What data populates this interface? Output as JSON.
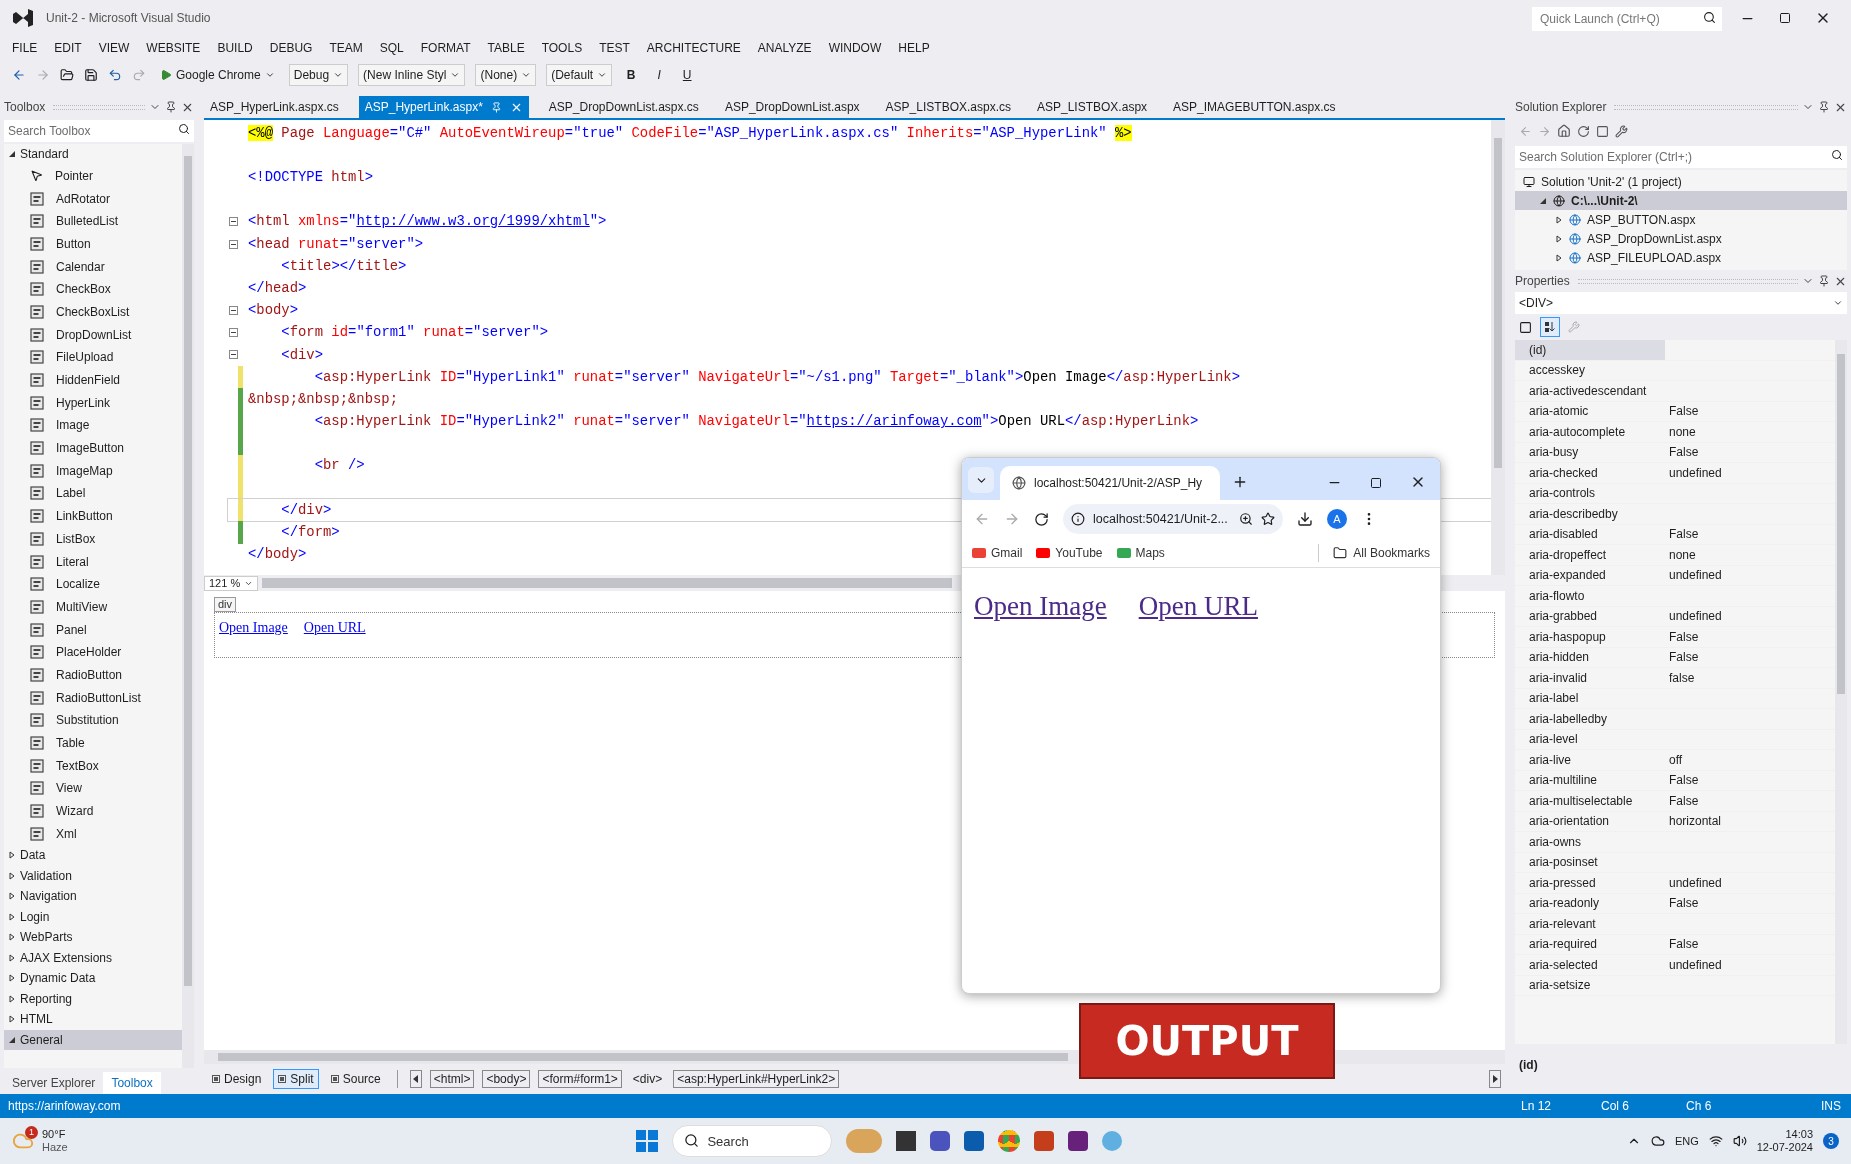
{
  "window": {
    "title": "Unit-2 - Microsoft Visual Studio",
    "quick_launch": {
      "placeholder": "Quick Launch (Ctrl+Q)"
    }
  },
  "menu": [
    "FILE",
    "EDIT",
    "VIEW",
    "WEBSITE",
    "BUILD",
    "DEBUG",
    "TEAM",
    "SQL",
    "FORMAT",
    "TABLE",
    "TOOLS",
    "TEST",
    "ARCHITECTURE",
    "ANALYZE",
    "WINDOW",
    "HELP"
  ],
  "toolbar": {
    "run": "Google Chrome",
    "configuration": "Debug",
    "style": "(New Inline Styl",
    "target_rule": "(None)",
    "font": "(Default",
    "format": [
      "B",
      "I",
      "U"
    ]
  },
  "toolbox": {
    "title": "Toolbox",
    "search": {
      "placeholder": "Search Toolbox"
    },
    "groups": [
      {
        "name": "Standard",
        "expanded": true,
        "selected": false,
        "items": [
          "Pointer",
          "AdRotator",
          "BulletedList",
          "Button",
          "Calendar",
          "CheckBox",
          "CheckBoxList",
          "DropDownList",
          "FileUpload",
          "HiddenField",
          "HyperLink",
          "Image",
          "ImageButton",
          "ImageMap",
          "Label",
          "LinkButton",
          "ListBox",
          "Literal",
          "Localize",
          "MultiView",
          "Panel",
          "PlaceHolder",
          "RadioButton",
          "RadioButtonList",
          "Substitution",
          "Table",
          "TextBox",
          "View",
          "Wizard",
          "Xml"
        ]
      },
      {
        "name": "Data",
        "expanded": false,
        "selected": false
      },
      {
        "name": "Validation",
        "expanded": false,
        "selected": false
      },
      {
        "name": "Navigation",
        "expanded": false,
        "selected": false
      },
      {
        "name": "Login",
        "expanded": false,
        "selected": false
      },
      {
        "name": "WebParts",
        "expanded": false,
        "selected": false
      },
      {
        "name": "AJAX Extensions",
        "expanded": false,
        "selected": false
      },
      {
        "name": "Dynamic Data",
        "expanded": false,
        "selected": false
      },
      {
        "name": "Reporting",
        "expanded": false,
        "selected": false
      },
      {
        "name": "HTML",
        "expanded": false,
        "selected": false
      },
      {
        "name": "General",
        "expanded": true,
        "selected": true
      }
    ]
  },
  "bottom_tabs": [
    {
      "label": "Server Explorer",
      "selected": false
    },
    {
      "label": "Toolbox",
      "selected": true
    }
  ],
  "editor": {
    "tabs": [
      {
        "label": "ASP_HyperLink.aspx.cs",
        "selected": false
      },
      {
        "label": "ASP_HyperLink.aspx*",
        "selected": true
      },
      {
        "label": "ASP_DropDownList.aspx.cs",
        "selected": false
      },
      {
        "label": "ASP_DropDownList.aspx",
        "selected": false
      },
      {
        "label": "ASP_LISTBOX.aspx.cs",
        "selected": false
      },
      {
        "label": "ASP_LISTBOX.aspx",
        "selected": false
      },
      {
        "label": "ASP_IMAGEBUTTON.aspx.cs",
        "selected": false
      }
    ],
    "lines": [
      {
        "tokens": [
          {
            "kind": "directive",
            "text": "<%@"
          },
          {
            "kind": "tag",
            "text": " Page"
          },
          {
            "kind": "attr",
            "text": " Language"
          },
          {
            "kind": "value",
            "text": "=\"C#\""
          },
          {
            "kind": "attr",
            "text": " AutoEventWireup"
          },
          {
            "kind": "value",
            "text": "=\"true\""
          },
          {
            "kind": "attr",
            "text": " CodeFile"
          },
          {
            "kind": "value",
            "text": "=\"ASP_HyperLink.aspx.cs\""
          },
          {
            "kind": "attr",
            "text": " Inherits"
          },
          {
            "kind": "value",
            "text": "=\"ASP_HyperLink\" "
          },
          {
            "kind": "directive",
            "text": "%>"
          }
        ],
        "modified": false,
        "fold": false,
        "current": false
      },
      {
        "modified": false,
        "fold": false,
        "current": false
      },
      {
        "tokens": [
          {
            "kind": "punct",
            "text": "<!DOCTYPE"
          },
          {
            "kind": "tag",
            "text": " html"
          },
          {
            "kind": "punct",
            "text": ">"
          }
        ],
        "modified": false,
        "fold": false,
        "current": false
      },
      {
        "modified": false,
        "fold": false,
        "current": false
      },
      {
        "tokens": [
          {
            "kind": "punct",
            "text": "<"
          },
          {
            "kind": "tag",
            "text": "html"
          },
          {
            "kind": "attr",
            "text": " xmlns"
          },
          {
            "kind": "punct",
            "text": "=\""
          },
          {
            "kind": "link",
            "text": "http://www.w3.org/1999/xhtml"
          },
          {
            "kind": "punct",
            "text": "\">"
          }
        ],
        "modified": false,
        "fold": true,
        "current": false
      },
      {
        "tokens": [
          {
            "kind": "punct",
            "text": "<"
          },
          {
            "kind": "tag",
            "text": "head"
          },
          {
            "kind": "attr",
            "text": " runat"
          },
          {
            "kind": "value",
            "text": "=\"server\""
          },
          {
            "kind": "punct",
            "text": ">"
          }
        ],
        "modified": false,
        "fold": true,
        "current": false
      },
      {
        "tokens": [
          {
            "kind": "punct",
            "text": "    <"
          },
          {
            "kind": "tag",
            "text": "title"
          },
          {
            "kind": "punct",
            "text": "></"
          },
          {
            "kind": "tag",
            "text": "title"
          },
          {
            "kind": "punct",
            "text": ">"
          }
        ],
        "modified": false,
        "fold": false,
        "current": false
      },
      {
        "tokens": [
          {
            "kind": "punct",
            "text": "</"
          },
          {
            "kind": "tag",
            "text": "head"
          },
          {
            "kind": "punct",
            "text": ">"
          }
        ],
        "modified": false,
        "fold": false,
        "current": false
      },
      {
        "tokens": [
          {
            "kind": "punct",
            "text": "<"
          },
          {
            "kind": "tag",
            "text": "body"
          },
          {
            "kind": "punct",
            "text": ">"
          }
        ],
        "modified": false,
        "fold": true,
        "current": false
      },
      {
        "tokens": [
          {
            "kind": "punct",
            "text": "    <"
          },
          {
            "kind": "tag",
            "text": "form"
          },
          {
            "kind": "attr",
            "text": " id"
          },
          {
            "kind": "value",
            "text": "=\"form1\""
          },
          {
            "kind": "attr",
            "text": " runat"
          },
          {
            "kind": "value",
            "text": "=\"server\""
          },
          {
            "kind": "punct",
            "text": ">"
          }
        ],
        "modified": false,
        "fold": true,
        "current": false
      },
      {
        "tokens": [
          {
            "kind": "punct",
            "text": "    <"
          },
          {
            "kind": "tag",
            "text": "div"
          },
          {
            "kind": "punct",
            "text": ">"
          }
        ],
        "modified": false,
        "fold": true,
        "current": false
      },
      {
        "tokens": [
          {
            "kind": "punct",
            "text": "        <"
          },
          {
            "kind": "tag",
            "text": "asp:HyperLink"
          },
          {
            "kind": "attr",
            "text": " ID"
          },
          {
            "kind": "value",
            "text": "=\"HyperLink1\""
          },
          {
            "kind": "attr",
            "text": " runat"
          },
          {
            "kind": "value",
            "text": "=\"server\""
          },
          {
            "kind": "attr",
            "text": " NavigateUrl"
          },
          {
            "kind": "value",
            "text": "=\"~/s1.png\""
          },
          {
            "kind": "attr",
            "text": " Target"
          },
          {
            "kind": "value",
            "text": "=\"_blank\""
          },
          {
            "kind": "punct",
            "text": ">"
          },
          {
            "kind": "text",
            "text": "Open Image"
          },
          {
            "kind": "punct",
            "text": "</"
          },
          {
            "kind": "tag",
            "text": "asp:HyperLink"
          },
          {
            "kind": "punct",
            "text": ">"
          }
        ],
        "modified": true,
        "saved": false,
        "fold": false,
        "current": false
      },
      {
        "tokens": [
          {
            "kind": "tag",
            "text": "&nbsp;&nbsp;&nbsp;"
          }
        ],
        "modified": true,
        "saved": true,
        "fold": false,
        "current": false
      },
      {
        "tokens": [
          {
            "kind": "punct",
            "text": "        <"
          },
          {
            "kind": "tag",
            "text": "asp:HyperLink"
          },
          {
            "kind": "attr",
            "text": " ID"
          },
          {
            "kind": "value",
            "text": "=\"HyperLink2\""
          },
          {
            "kind": "attr",
            "text": " runat"
          },
          {
            "kind": "value",
            "text": "=\"server\""
          },
          {
            "kind": "attr",
            "text": " NavigateUrl"
          },
          {
            "kind": "value",
            "text": "=\""
          },
          {
            "kind": "link",
            "text": "https://arinfoway.com"
          },
          {
            "kind": "value",
            "text": "\""
          },
          {
            "kind": "punct",
            "text": ">"
          },
          {
            "kind": "text",
            "text": "Open URL"
          },
          {
            "kind": "punct",
            "text": "</"
          },
          {
            "kind": "tag",
            "text": "asp:HyperLink"
          },
          {
            "kind": "punct",
            "text": ">"
          }
        ],
        "modified": true,
        "saved": true,
        "fold": false,
        "current": false
      },
      {
        "modified": true,
        "saved": true,
        "fold": false,
        "current": false
      },
      {
        "tokens": [
          {
            "kind": "punct",
            "text": "        <"
          },
          {
            "kind": "tag",
            "text": "br"
          },
          {
            "kind": "punct",
            "text": " />"
          }
        ],
        "modified": true,
        "saved": false,
        "fold": false,
        "current": false
      },
      {
        "modified": true,
        "saved": false,
        "fold": false,
        "current": false
      },
      {
        "tokens": [
          {
            "kind": "punct",
            "text": "    </"
          },
          {
            "kind": "tag",
            "text": "div"
          },
          {
            "kind": "punct",
            "text": ">"
          }
        ],
        "modified": true,
        "saved": false,
        "fold": false,
        "current": true
      },
      {
        "tokens": [
          {
            "kind": "punct",
            "text": "    </"
          },
          {
            "kind": "tag",
            "text": "form"
          },
          {
            "kind": "punct",
            "text": ">"
          }
        ],
        "modified": true,
        "saved": true,
        "fold": false,
        "current": false
      },
      {
        "tokens": [
          {
            "kind": "punct",
            "text": "</"
          },
          {
            "kind": "tag",
            "text": "body"
          },
          {
            "kind": "punct",
            "text": ">"
          }
        ],
        "modified": false,
        "fold": false,
        "current": false
      }
    ],
    "zoom": "121 %",
    "design": {
      "tag": "div",
      "links": [
        "Open Image",
        "Open URL"
      ]
    },
    "views": [
      {
        "label": "Design",
        "selected": false
      },
      {
        "label": "Split",
        "selected": true
      },
      {
        "label": "Source",
        "selected": false
      }
    ],
    "breadcrumbs": [
      "<html>",
      "<body>",
      "<form#form1>",
      "<div>",
      "<asp:HyperLink#HyperLink2>"
    ]
  },
  "solution_explorer": {
    "title": "Solution Explorer",
    "search": {
      "placeholder": "Search Solution Explorer (Ctrl+;)"
    },
    "tree": [
      {
        "label": "Solution 'Unit-2' (1 project)",
        "selected": false,
        "children": [
          {
            "label": "C:\\...\\Unit-2\\",
            "selected": true,
            "expanded": true,
            "children": [
              {
                "label": "ASP_BUTTON.aspx",
                "selected": false,
                "expanded": false
              },
              {
                "label": "ASP_DropDownList.aspx",
                "selected": false,
                "expanded": false
              },
              {
                "label": "ASP_FILEUPLOAD.aspx",
                "selected": false,
                "expanded": false
              }
            ]
          }
        ]
      }
    ]
  },
  "properties": {
    "title": "Properties",
    "object": "<DIV>",
    "rows": [
      {
        "name": "(id)",
        "selected": true
      },
      {
        "name": "accesskey",
        "selected": false
      },
      {
        "name": "aria-activedescendant",
        "selected": false
      },
      {
        "name": "aria-atomic",
        "value": "False",
        "selected": false
      },
      {
        "name": "aria-autocomplete",
        "value": "none",
        "selected": false
      },
      {
        "name": "aria-busy",
        "value": "False",
        "selected": false
      },
      {
        "name": "aria-checked",
        "value": "undefined",
        "selected": false
      },
      {
        "name": "aria-controls",
        "selected": false
      },
      {
        "name": "aria-describedby",
        "selected": false
      },
      {
        "name": "aria-disabled",
        "value": "False",
        "selected": false
      },
      {
        "name": "aria-dropeffect",
        "value": "none",
        "selected": false
      },
      {
        "name": "aria-expanded",
        "value": "undefined",
        "selected": false
      },
      {
        "name": "aria-flowto",
        "selected": false
      },
      {
        "name": "aria-grabbed",
        "value": "undefined",
        "selected": false
      },
      {
        "name": "aria-haspopup",
        "value": "False",
        "selected": false
      },
      {
        "name": "aria-hidden",
        "value": "False",
        "selected": false
      },
      {
        "name": "aria-invalid",
        "value": "false",
        "selected": false
      },
      {
        "name": "aria-label",
        "selected": false
      },
      {
        "name": "aria-labelledby",
        "selected": false
      },
      {
        "name": "aria-level",
        "selected": false
      },
      {
        "name": "aria-live",
        "value": "off",
        "selected": false
      },
      {
        "name": "aria-multiline",
        "value": "False",
        "selected": false
      },
      {
        "name": "aria-multiselectable",
        "value": "False",
        "selected": false
      },
      {
        "name": "aria-orientation",
        "value": "horizontal",
        "selected": false
      },
      {
        "name": "aria-owns",
        "selected": false
      },
      {
        "name": "aria-posinset",
        "selected": false
      },
      {
        "name": "aria-pressed",
        "value": "undefined",
        "selected": false
      },
      {
        "name": "aria-readonly",
        "value": "False",
        "selected": false
      },
      {
        "name": "aria-relevant",
        "selected": false
      },
      {
        "name": "aria-required",
        "value": "False",
        "selected": false
      },
      {
        "name": "aria-selected",
        "value": "undefined",
        "selected": false
      },
      {
        "name": "aria-setsize",
        "selected": false
      }
    ],
    "description": "(id)"
  },
  "status_bar": {
    "text": "https://arinfoway.com",
    "line": "Ln 12",
    "column": "Col 6",
    "char": "Ch 6",
    "mode": "INS"
  },
  "browser": {
    "tab_title": "localhost:50421/Unit-2/ASP_Hy",
    "address": "localhost:50421/Unit-2...",
    "avatar": "A",
    "bookmarks": [
      "Gmail",
      "YouTube",
      "Maps"
    ],
    "all_bookmarks": "All Bookmarks",
    "links": [
      "Open Image",
      "Open URL"
    ]
  },
  "banner": "OUTPUT",
  "taskbar": {
    "weather_badge": "1",
    "temperature": "90°F",
    "condition": "Haze",
    "search": {
      "placeholder": "Search"
    },
    "language": "ENG",
    "time": "14:03",
    "date": "12-07-2024",
    "notifications": "3"
  }
}
